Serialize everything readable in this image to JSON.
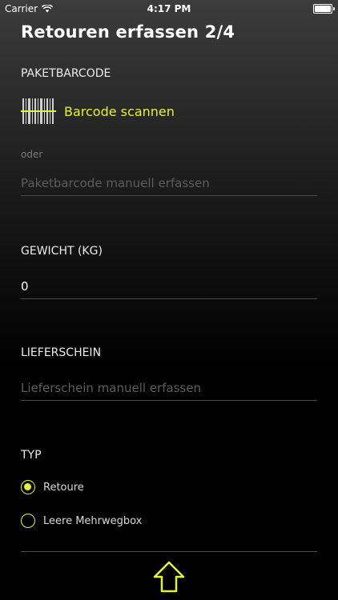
{
  "status_bar": {
    "carrier": "Carrier",
    "time": "4:17 PM"
  },
  "title": "Retouren erfassen 2/4",
  "paketbarcode": {
    "label": "PAKETBARCODE",
    "scan_label": "Barcode scannen",
    "or_label": "oder",
    "placeholder": "Paketbarcode manuell erfassen",
    "value": ""
  },
  "gewicht": {
    "label": "GEWICHT (KG)",
    "value": "0"
  },
  "lieferschein": {
    "label": "LIEFERSCHEIN",
    "placeholder": "Lieferschein manuell erfassen",
    "value": ""
  },
  "typ": {
    "label": "TYP",
    "options": [
      {
        "label": "Retoure",
        "selected": true
      },
      {
        "label": "Leere Mehrwegbox",
        "selected": false
      }
    ]
  },
  "colors": {
    "accent": "#e4f23a",
    "background": "#000000",
    "divider": "#4a4a4a"
  },
  "icons": {
    "scan": "barcode-icon",
    "next": "up-arrow-icon",
    "wifi": "wifi-icon",
    "battery": "battery-icon"
  }
}
